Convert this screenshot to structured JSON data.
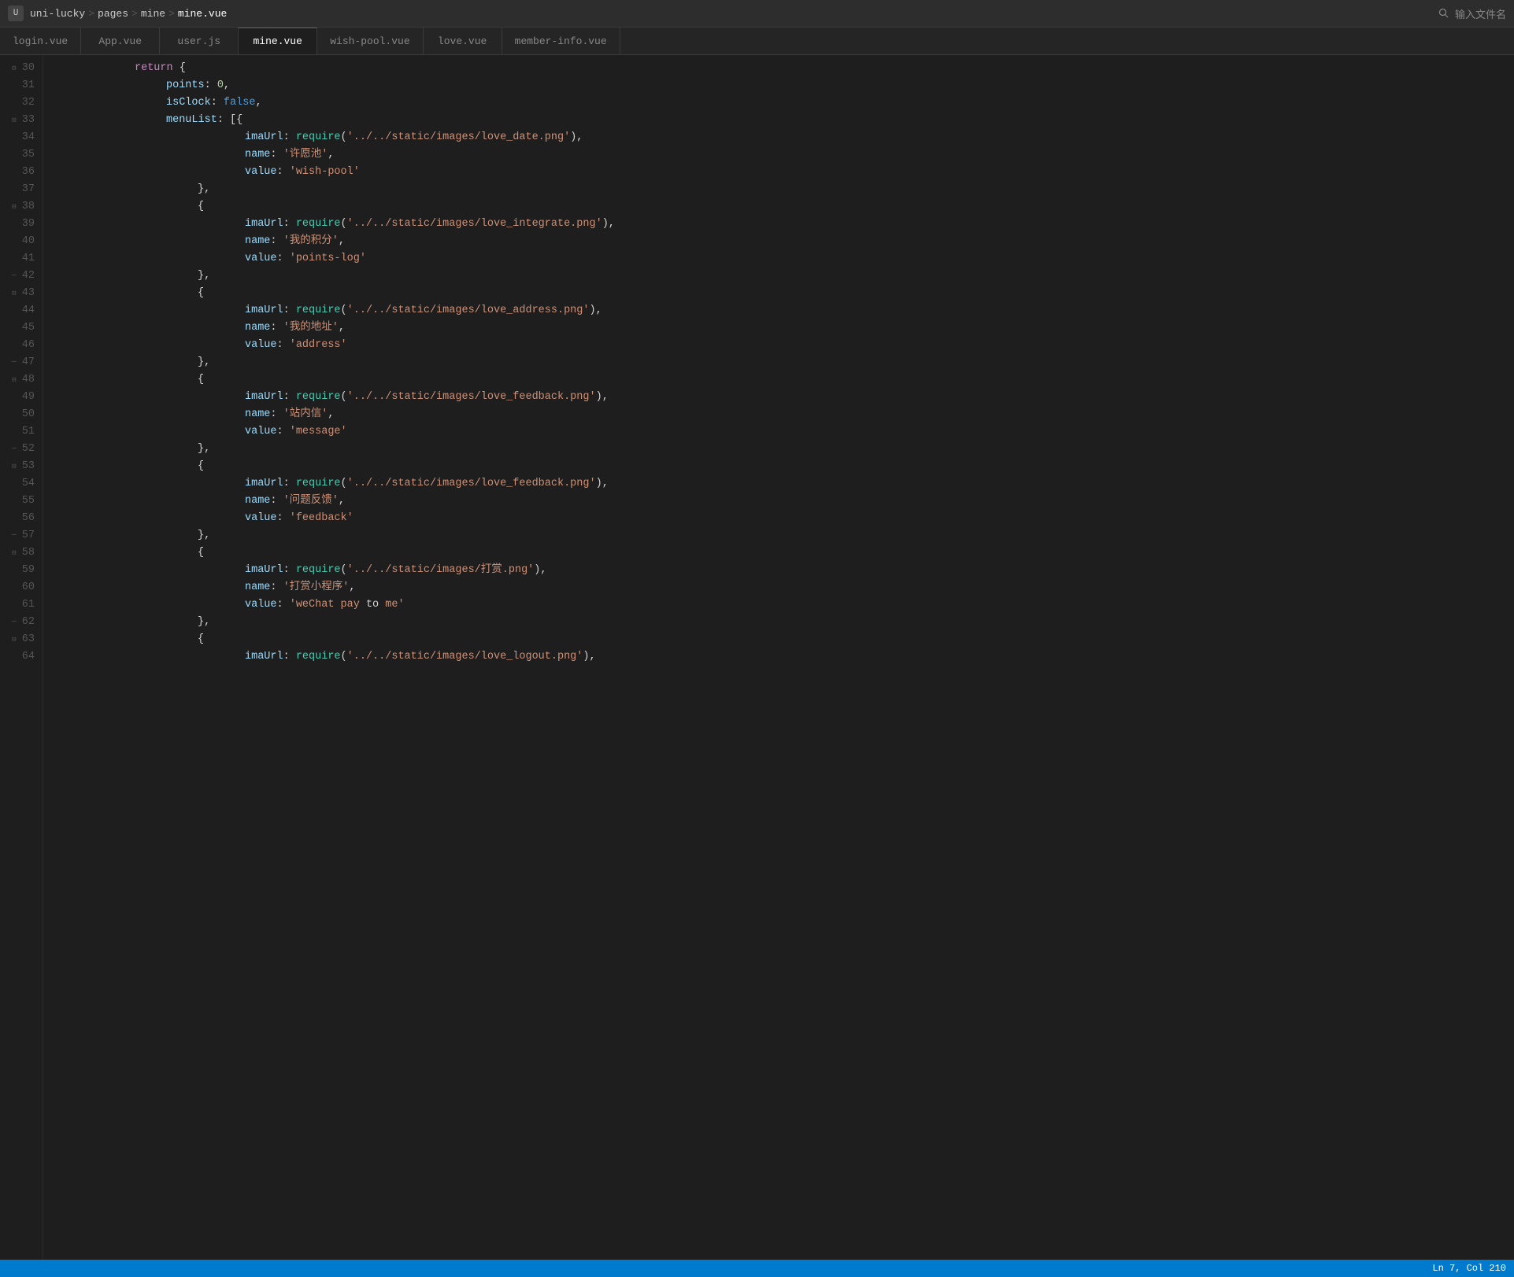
{
  "titleBar": {
    "logo": "U",
    "breadcrumb": [
      "uni-lucky",
      "pages",
      "mine",
      "mine.vue"
    ],
    "searchPlaceholder": "输入文件名"
  },
  "tabs": [
    {
      "label": "login.vue",
      "active": false
    },
    {
      "label": "App.vue",
      "active": false
    },
    {
      "label": "user.js",
      "active": false
    },
    {
      "label": "mine.vue",
      "active": true
    },
    {
      "label": "wish-pool.vue",
      "active": false
    },
    {
      "label": "love.vue",
      "active": false
    },
    {
      "label": "member-info.vue",
      "active": false
    }
  ],
  "lines": [
    {
      "num": 30,
      "fold": "open",
      "content": "return_open"
    },
    {
      "num": 31,
      "fold": "none",
      "content": "points_0"
    },
    {
      "num": 32,
      "fold": "none",
      "content": "isClock_false"
    },
    {
      "num": 33,
      "fold": "open",
      "content": "menuList_open"
    },
    {
      "num": 34,
      "fold": "none",
      "content": "imaUrl_love_date"
    },
    {
      "num": 35,
      "fold": "none",
      "content": "name_wish_pool_zh"
    },
    {
      "num": 36,
      "fold": "none",
      "content": "value_wish_pool"
    },
    {
      "num": 37,
      "fold": "none",
      "content": "close_brace_comma"
    },
    {
      "num": 38,
      "fold": "open",
      "content": "open_brace"
    },
    {
      "num": 39,
      "fold": "none",
      "content": "imaUrl_love_integrate"
    },
    {
      "num": 40,
      "fold": "none",
      "content": "name_my_points_zh"
    },
    {
      "num": 41,
      "fold": "none",
      "content": "value_points_log"
    },
    {
      "num": 42,
      "fold": "dash",
      "content": "close_brace_comma_2"
    },
    {
      "num": 43,
      "fold": "open",
      "content": "open_brace_2"
    },
    {
      "num": 44,
      "fold": "none",
      "content": "imaUrl_love_address"
    },
    {
      "num": 45,
      "fold": "none",
      "content": "name_my_address_zh"
    },
    {
      "num": 46,
      "fold": "none",
      "content": "value_address"
    },
    {
      "num": 47,
      "fold": "dash",
      "content": "close_brace_comma_3"
    },
    {
      "num": 48,
      "fold": "open",
      "content": "open_brace_3"
    },
    {
      "num": 49,
      "fold": "none",
      "content": "imaUrl_love_feedback_1"
    },
    {
      "num": 50,
      "fold": "none",
      "content": "name_station_msg_zh"
    },
    {
      "num": 51,
      "fold": "none",
      "content": "value_message"
    },
    {
      "num": 52,
      "fold": "dash",
      "content": "close_brace_comma_4"
    },
    {
      "num": 53,
      "fold": "open",
      "content": "open_brace_4"
    },
    {
      "num": 54,
      "fold": "none",
      "content": "imaUrl_love_feedback_2"
    },
    {
      "num": 55,
      "fold": "none",
      "content": "name_feedback_zh"
    },
    {
      "num": 56,
      "fold": "none",
      "content": "value_feedback"
    },
    {
      "num": 57,
      "fold": "dash",
      "content": "close_brace_comma_5"
    },
    {
      "num": 58,
      "fold": "open",
      "content": "open_brace_5"
    },
    {
      "num": 59,
      "fold": "none",
      "content": "imaUrl_reward"
    },
    {
      "num": 60,
      "fold": "none",
      "content": "name_reward_zh"
    },
    {
      "num": 61,
      "fold": "none",
      "content": "value_weChat_pay"
    },
    {
      "num": 62,
      "fold": "dash",
      "content": "close_brace_comma_6"
    },
    {
      "num": 63,
      "fold": "open",
      "content": "open_brace_6"
    },
    {
      "num": 64,
      "fold": "none",
      "content": "imaUrl_love_logout"
    }
  ],
  "statusBar": {
    "position": "Ln 7, Col 210"
  }
}
